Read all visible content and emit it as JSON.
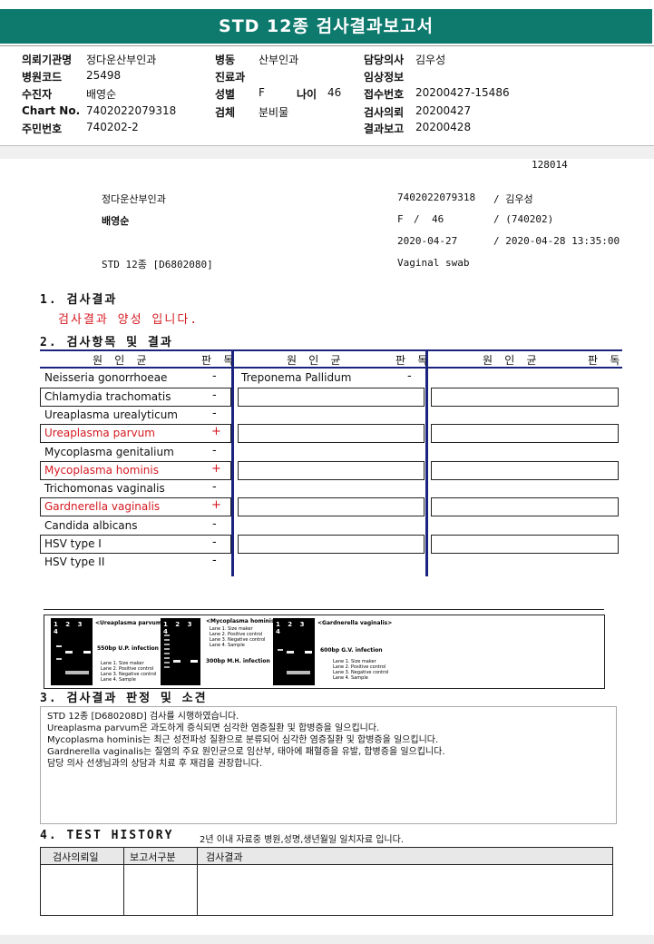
{
  "title": "STD 12종 검사결과보고서",
  "header": {
    "col1": [
      {
        "label": "의뢰기관명",
        "value": "정다운산부인과"
      },
      {
        "label": "병원코드",
        "value": "25498"
      },
      {
        "label": "수진자",
        "value": "배영순"
      },
      {
        "label": "Chart No.",
        "value": "7402022079318"
      },
      {
        "label": "주민번호",
        "value": "740202-2"
      }
    ],
    "col2": [
      {
        "label": "병동",
        "value": "산부인과"
      },
      {
        "label": "진료과",
        "value": ""
      },
      {
        "label": "성별",
        "value": "F"
      },
      {
        "label": "검체",
        "value": "분비물"
      }
    ],
    "age": {
      "label": "나이",
      "value": "46"
    },
    "col3": [
      {
        "label": "담당의사",
        "value": "김우성"
      },
      {
        "label": "임상정보",
        "value": ""
      },
      {
        "label": "접수번호",
        "value": "20200427-15486"
      },
      {
        "label": "검사의뢰",
        "value": "20200427"
      },
      {
        "label": "결과보고",
        "value": "20200428"
      }
    ]
  },
  "report": {
    "number": "128014",
    "hospital": "정다운산부인과",
    "chart": "7402022079318",
    "doctor": "/ 김우성",
    "patient": "배영순",
    "sex": "F",
    "slash": "/",
    "age": "46",
    "birth": "/ (740202)",
    "date_req": "2020-04-27",
    "date_rep": "/ 2020-04-28 13:35:00",
    "test": "STD 12종 [D6802080]",
    "specimen": "Vaginal swab"
  },
  "section1": {
    "title": "1. 검사결과",
    "summary": "검사결과 양성 입니다."
  },
  "section2": {
    "title": "2. 검사항목 및 결과",
    "col_pathogen": "원 인 균",
    "col_result": "판 독",
    "rows": [
      {
        "name": "Neisseria gonorrhoeae",
        "result": "-",
        "positive": false
      },
      {
        "name": "Chlamydia trachomatis",
        "result": "-",
        "positive": false
      },
      {
        "name": "Ureaplasma urealyticum",
        "result": "-",
        "positive": false
      },
      {
        "name": "Ureaplasma parvum",
        "result": "+",
        "positive": true
      },
      {
        "name": "Mycoplasma genitalium",
        "result": "-",
        "positive": false
      },
      {
        "name": "Mycoplasma hominis",
        "result": "+",
        "positive": true
      },
      {
        "name": "Trichomonas vaginalis",
        "result": "-",
        "positive": false
      },
      {
        "name": "Gardnerella vaginalis",
        "result": "+",
        "positive": true
      },
      {
        "name": "Candida albicans",
        "result": "-",
        "positive": false
      },
      {
        "name": "HSV type I",
        "result": "-",
        "positive": false
      },
      {
        "name": "HSV type II",
        "result": "-",
        "positive": false
      }
    ],
    "middle_first": {
      "name": "Treponema Pallidum",
      "result": "-"
    }
  },
  "gels": [
    {
      "title": "<Ureaplasma parvum>",
      "lanes": "1 2 3 4",
      "band": "550bp U.P. infection",
      "legend": [
        "Lane 1. Size maker",
        "Lane 2. Positive control",
        "Lane 3. Negative control",
        "Lane 4. Sample"
      ]
    },
    {
      "title": "<Mycoplasma hominis>",
      "lanes": "1 2 3 4",
      "band": "300bp M.H. infection",
      "legend": [
        "Lane 1. Size maker",
        "Lane 2. Positive control",
        "Lane 3. Negative control",
        "Lane 4. Sample"
      ]
    },
    {
      "title": "<Gardnerella vaginalis>",
      "lanes": "1 2 3 4",
      "band": "600bp G.V. infection",
      "legend": [
        "Lane 1. Size maker",
        "Lane 2. Positive control",
        "Lane 3. Negative control",
        "Lane 4. Sample"
      ]
    }
  ],
  "section3": {
    "title": "3. 검사결과 판정 및 소견",
    "lines": [
      "STD 12종 [D680208D] 검사를 시행하였습니다.",
      "Ureaplasma parvum은 과도하게 증식되면 심각한 염증질환 및 합병증을 일으킵니다.",
      "Mycoplasma hominis는 최근 성전파성 질환으로 분류되어 심각한 염증질환 및 합병증을 일으킵니다.",
      "Gardnerella vaginalis는 질염의 주요 원인균으로 임산부, 태아에 패혈증을 유발, 합병증을 일으킵니다.",
      "담당 의사 선생님과의 상담과 치료 후 재검을 권장합니다."
    ]
  },
  "section4": {
    "title": "4. TEST HISTORY",
    "note": "2년 이내 자료중 병원,성명,생년월일 일치자료 입니다.",
    "headers": [
      "검사의뢰일",
      "보고서구분",
      "검사결과"
    ]
  },
  "colors": {
    "header_bg": "#0e7a6e",
    "positive": "#d51921",
    "divider": "#1a237e"
  }
}
